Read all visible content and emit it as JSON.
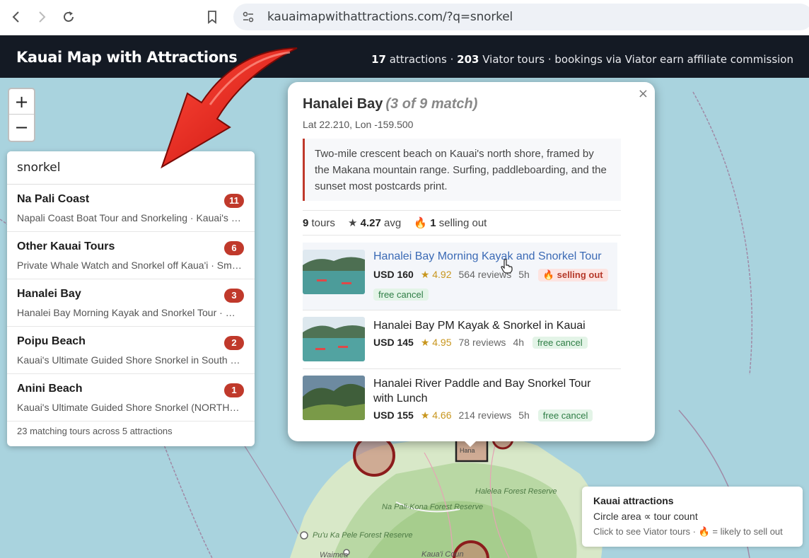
{
  "browser": {
    "url": "kauaimapwithattractions.com/?q=snorkel"
  },
  "header": {
    "title": "Kauai Map with Attractions",
    "stats_attractions": "17",
    "stats_attractions_label": "attractions",
    "stats_tours": "203",
    "stats_tours_label": "Viator tours · bookings via Viator earn affiliate commission"
  },
  "map": {
    "labels": [
      "Halelea Forest Reserve",
      "Na Pali-Kona Forest Reserve",
      "Pu'u Ka Pele Forest Reserve",
      "Waimea",
      "Kaua'i Coun"
    ],
    "highlight_label": "Hana"
  },
  "zoom": {
    "in": "+",
    "out": "−"
  },
  "search": {
    "query": "snorkel",
    "results": [
      {
        "name": "Na Pali Coast",
        "count": "11",
        "sub": "Napali Coast Boat Tour and Snorkeling · Kauai's Hidden Gems"
      },
      {
        "name": "Other Kauai Tours",
        "count": "6",
        "sub": "Private Whale Watch and Snorkel off Kaua'i · Small Group"
      },
      {
        "name": "Hanalei Bay",
        "count": "3",
        "sub": "Hanalei Bay Morning Kayak and Snorkel Tour · Hanalei Bay PM Kayak"
      },
      {
        "name": "Poipu Beach",
        "count": "2",
        "sub": "Kauai's Ultimate Guided Shore Snorkel in South Shore"
      },
      {
        "name": "Anini Beach",
        "count": "1",
        "sub": "Kauai's Ultimate Guided Shore Snorkel (NORTH SHORE)"
      }
    ],
    "footer": "23 matching tours across 5 attractions"
  },
  "popup": {
    "title": "Hanalei Bay",
    "match": "(3 of 9 match)",
    "coords": "Lat 22.210, Lon -159.500",
    "description": "Two-mile crescent beach on Kauai's north shore, framed by the Makana mountain range. Surfing, paddleboarding, and the sunset most postcards print.",
    "tours_count": "9",
    "tours_label": "tours",
    "avg_rating": "4.27",
    "avg_label": "avg",
    "selling_count": "1",
    "selling_label": "selling out",
    "close": "×",
    "tours": [
      {
        "name": "Hanalei Bay Morning Kayak and Snorkel Tour",
        "price": "USD 160",
        "rating": "★ 4.92",
        "reviews": "564 reviews",
        "duration": "5h",
        "selling": "selling out",
        "cancel": "free cancel"
      },
      {
        "name": "Hanalei Bay PM Kayak & Snorkel in Kauai",
        "price": "USD 145",
        "rating": "★ 4.95",
        "reviews": "78 reviews",
        "duration": "4h",
        "cancel": "free cancel"
      },
      {
        "name": "Hanalei River Paddle and Bay Snorkel Tour with Lunch",
        "price": "USD 155",
        "rating": "★ 4.66",
        "reviews": "214 reviews",
        "duration": "5h",
        "cancel": "free cancel"
      }
    ]
  },
  "legend": {
    "title": "Kauai attractions",
    "line": "Circle area ∝ tour count",
    "note_a": "Click to see Viator tours ·",
    "note_b": "= likely to sell out"
  },
  "colors": {
    "accent": "#c0392b",
    "header_bg": "#141a24",
    "link": "#3b6ab5",
    "ocean": "#a9d3de"
  }
}
